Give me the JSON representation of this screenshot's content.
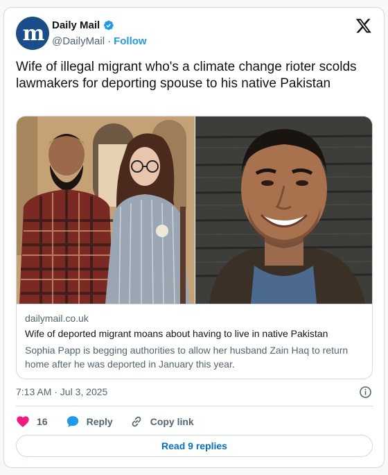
{
  "author": {
    "name": "Daily Mail",
    "handle": "@DailyMail",
    "separator": "·",
    "follow_label": "Follow",
    "avatar_glyph": "m",
    "avatar_color": "#1a4e8a",
    "verified_color": "#1d9bf0"
  },
  "tweet": {
    "text": "Wife of illegal migrant who's a climate change rioter scolds lawmakers for deporting spouse to his native Pakistan"
  },
  "link_card": {
    "domain": "dailymail.co.uk",
    "title": "Wife of deported migrant moans about having to live in native Pakistan",
    "description": "Sophia Papp is begging authorities to allow her husband Zain Haq to return home after he was deported in January this year."
  },
  "meta": {
    "timestamp": "7:13 AM · Jul 3, 2025"
  },
  "actions": {
    "like_count": "16",
    "reply_label": "Reply",
    "copy_link_label": "Copy link",
    "read_replies_label": "Read 9 replies",
    "like_color": "#f91880",
    "reply_color": "#1d9bf0"
  }
}
